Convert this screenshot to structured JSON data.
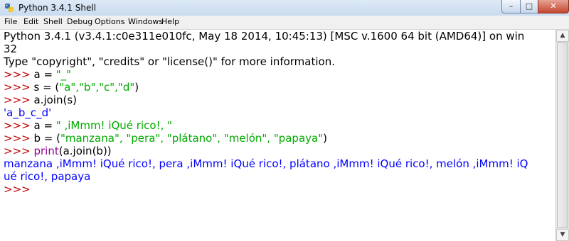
{
  "window": {
    "title": "Python 3.4.1 Shell",
    "min_glyph": "–",
    "max_glyph": "□",
    "close_glyph": "✕",
    "app_icon": "python-icon"
  },
  "menu": {
    "items": [
      {
        "label": "File"
      },
      {
        "label": "Edit"
      },
      {
        "label": "Shell"
      },
      {
        "label": "Debug"
      },
      {
        "label": "Options"
      },
      {
        "label": "Windows"
      },
      {
        "label": "Help"
      }
    ]
  },
  "shell": {
    "banner_line1": "Python 3.4.1 (v3.4.1:c0e311e010fc, May 18 2014, 10:45:13) [MSC v.1600 64 bit (AMD64)] on win",
    "banner_line2": "32",
    "banner_line3": "Type \"copyright\", \"credits\" or \"license()\" for more information.",
    "prompt": ">>> ",
    "l4_code": "a = ",
    "l4_str": "\"_\"",
    "l5_code_a": "s = (",
    "l5_str": "\"a\",\"b\",\"c\",\"d\"",
    "l5_code_b": ")",
    "l6_code": "a.join(s)",
    "l7_out": "'a_b_c_d'",
    "l8_code": "a = ",
    "l8_str": "\" ,iMmm! iQué rico!, \"",
    "l9_code_a": "b = (",
    "l9_str": "\"manzana\", \"pera\", \"plátano\", \"melón\", \"papaya\"",
    "l9_code_b": ")",
    "l10_builtin": "print",
    "l10_code": "(a.join(b))",
    "l11_out": "manzana ,iMmm! iQué rico!, pera ,iMmm! iQué rico!, plátano ,iMmm! iQué rico!, melón ,iMmm! iQ",
    "l12_out": "ué rico!, papaya",
    "last_prompt": ">>> "
  },
  "colors": {
    "prompt": "#c00000",
    "string": "#00aa00",
    "output": "#0000ff",
    "builtin": "#900090"
  }
}
